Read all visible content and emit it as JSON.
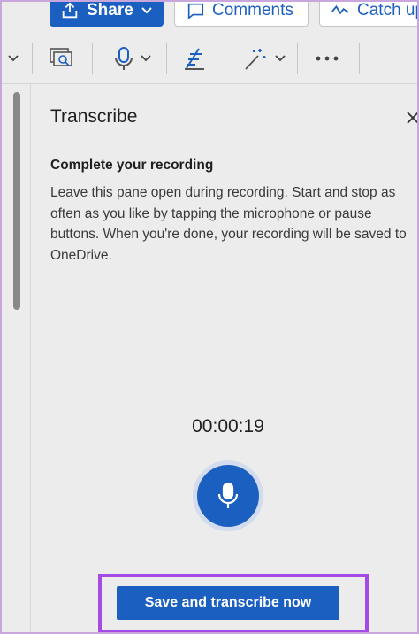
{
  "topbar": {
    "share_label": "Share",
    "comments_label": "Comments",
    "catchup_label": "Catch up"
  },
  "ribbon": {
    "icons": [
      "chevron-down-icon",
      "focus-view-icon",
      "dictate-mic-icon",
      "editor-icon",
      "designer-icon",
      "more-icon"
    ]
  },
  "pane": {
    "title": "Transcribe",
    "subtitle": "Complete your recording",
    "instructions": "Leave this pane open during recording. Start and stop as often as you like by tapping the microphone or pause buttons. When you're done, your recording will be saved to OneDrive.",
    "timer": "00:00:19",
    "save_button_label": "Save and transcribe now"
  },
  "colors": {
    "accent": "#1b5fc1",
    "highlight": "#a64ae6",
    "background": "#ececec"
  }
}
